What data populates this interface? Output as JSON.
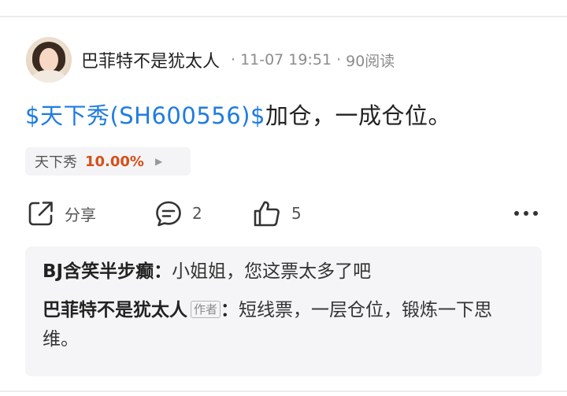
{
  "post": {
    "author": "巴菲特不是犹太人",
    "date": "11-07 19:51",
    "views": "90阅读",
    "stock_link": "$天下秀(SH600556)$",
    "text": "加仓，一成仓位。"
  },
  "stock_chip": {
    "name": "天下秀",
    "change": "10.00%",
    "arrow_icon": "triangle-right-icon",
    "change_color": "#d45019"
  },
  "actions": {
    "share_label": "分享",
    "comment_count": "2",
    "like_count": "5"
  },
  "comments": [
    {
      "author": "BJ含笑半步癫",
      "colon": "：",
      "text": "小姐姐，您这票太多了吧"
    },
    {
      "author": "巴菲特不是犹太人",
      "badge": "作者",
      "colon": "：",
      "text": "短线票，一层仓位，锻炼一下思维。"
    }
  ],
  "colors": {
    "link": "#1f7ce0",
    "text": "#222222",
    "meta": "#8c8c8c"
  }
}
